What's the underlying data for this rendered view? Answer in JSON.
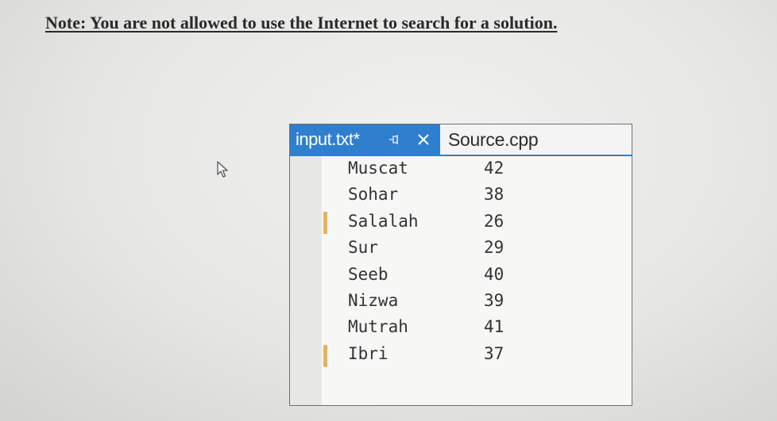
{
  "note": {
    "text": "Note: You are not allowed to use the Internet to search for a solution."
  },
  "editor": {
    "tabs": [
      {
        "label": "input.txt*",
        "active": true
      },
      {
        "label": "Source.cpp",
        "active": false
      }
    ],
    "lines": [
      {
        "city": "Muscat",
        "value": "42",
        "changed": false
      },
      {
        "city": "Sohar",
        "value": "38",
        "changed": false
      },
      {
        "city": "Salalah",
        "value": "26",
        "changed": true
      },
      {
        "city": "Sur",
        "value": "29",
        "changed": false
      },
      {
        "city": "Seeb",
        "value": "40",
        "changed": false
      },
      {
        "city": "Nizwa",
        "value": "39",
        "changed": false
      },
      {
        "city": "Mutrah",
        "value": "41",
        "changed": false
      },
      {
        "city": "Ibri",
        "value": "37",
        "changed": true
      }
    ]
  },
  "colors": {
    "tab_accent": "#2f7fcf",
    "change_marker": "#e8b25a"
  },
  "icons": {
    "pin": "pin-icon",
    "close": "close-icon",
    "cursor": "mouse-pointer-icon"
  }
}
